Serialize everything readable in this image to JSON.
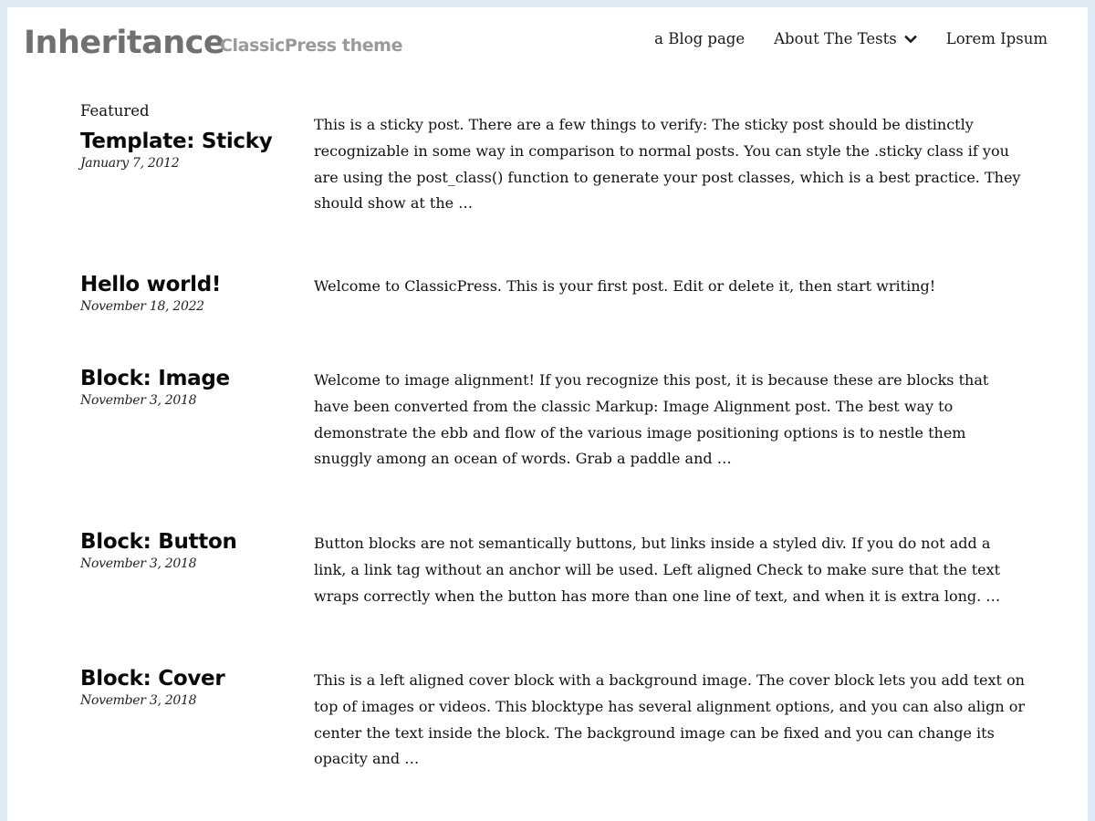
{
  "header": {
    "site_title": "Inheritance",
    "tagline": "ClassicPress theme",
    "nav": [
      {
        "label": "a Blog page",
        "has_dropdown": false
      },
      {
        "label": "About The Tests",
        "has_dropdown": true,
        "icon": "chevron-down-icon"
      },
      {
        "label": "Lorem Ipsum",
        "has_dropdown": false
      }
    ]
  },
  "posts": [
    {
      "featured_label": "Featured",
      "title": "Template: Sticky",
      "date": "January 7, 2012",
      "excerpt": "This is a sticky post. There are a few things to verify: The sticky post should be distinctly recognizable in some way in comparison to normal posts. You can style the .sticky class if you are using the post_class() function to generate your post classes, which is a best practice. They should show at the …"
    },
    {
      "title": "Hello world!",
      "date": "November 18, 2022",
      "excerpt": "Welcome to ClassicPress. This is your first post. Edit or delete it, then start writing!"
    },
    {
      "title": "Block: Image",
      "date": "November 3, 2018",
      "excerpt": "Welcome to image alignment! If you recognize this post, it is because these are blocks that have been converted from the classic Markup: Image Alignment post. The best way to demonstrate the ebb and flow of the various image positioning options is to nestle them snuggly among an ocean of words. Grab a paddle and …"
    },
    {
      "title": "Block: Button",
      "date": "November 3, 2018",
      "excerpt": "Button blocks are not semantically buttons, but links inside a styled div.  If you do not add a link, a link tag without an anchor will be used. Left aligned Check to make sure that the text wraps correctly when the button has more than one line of text, and when it is extra long. …"
    },
    {
      "title": "Block: Cover",
      "date": "November 3, 2018",
      "excerpt": "This is a left aligned cover block with a background image. The cover block lets you add text on top of images or videos. This blocktype has several alignment options, and you can also align or center the text inside the block. The background image can be fixed and you can change its opacity and …"
    }
  ],
  "colors": {
    "page_background": "#ddeaf3",
    "content_background": "#ffffff",
    "site_title": "#707070",
    "tagline": "#9a9a9a",
    "text": "#111111"
  }
}
